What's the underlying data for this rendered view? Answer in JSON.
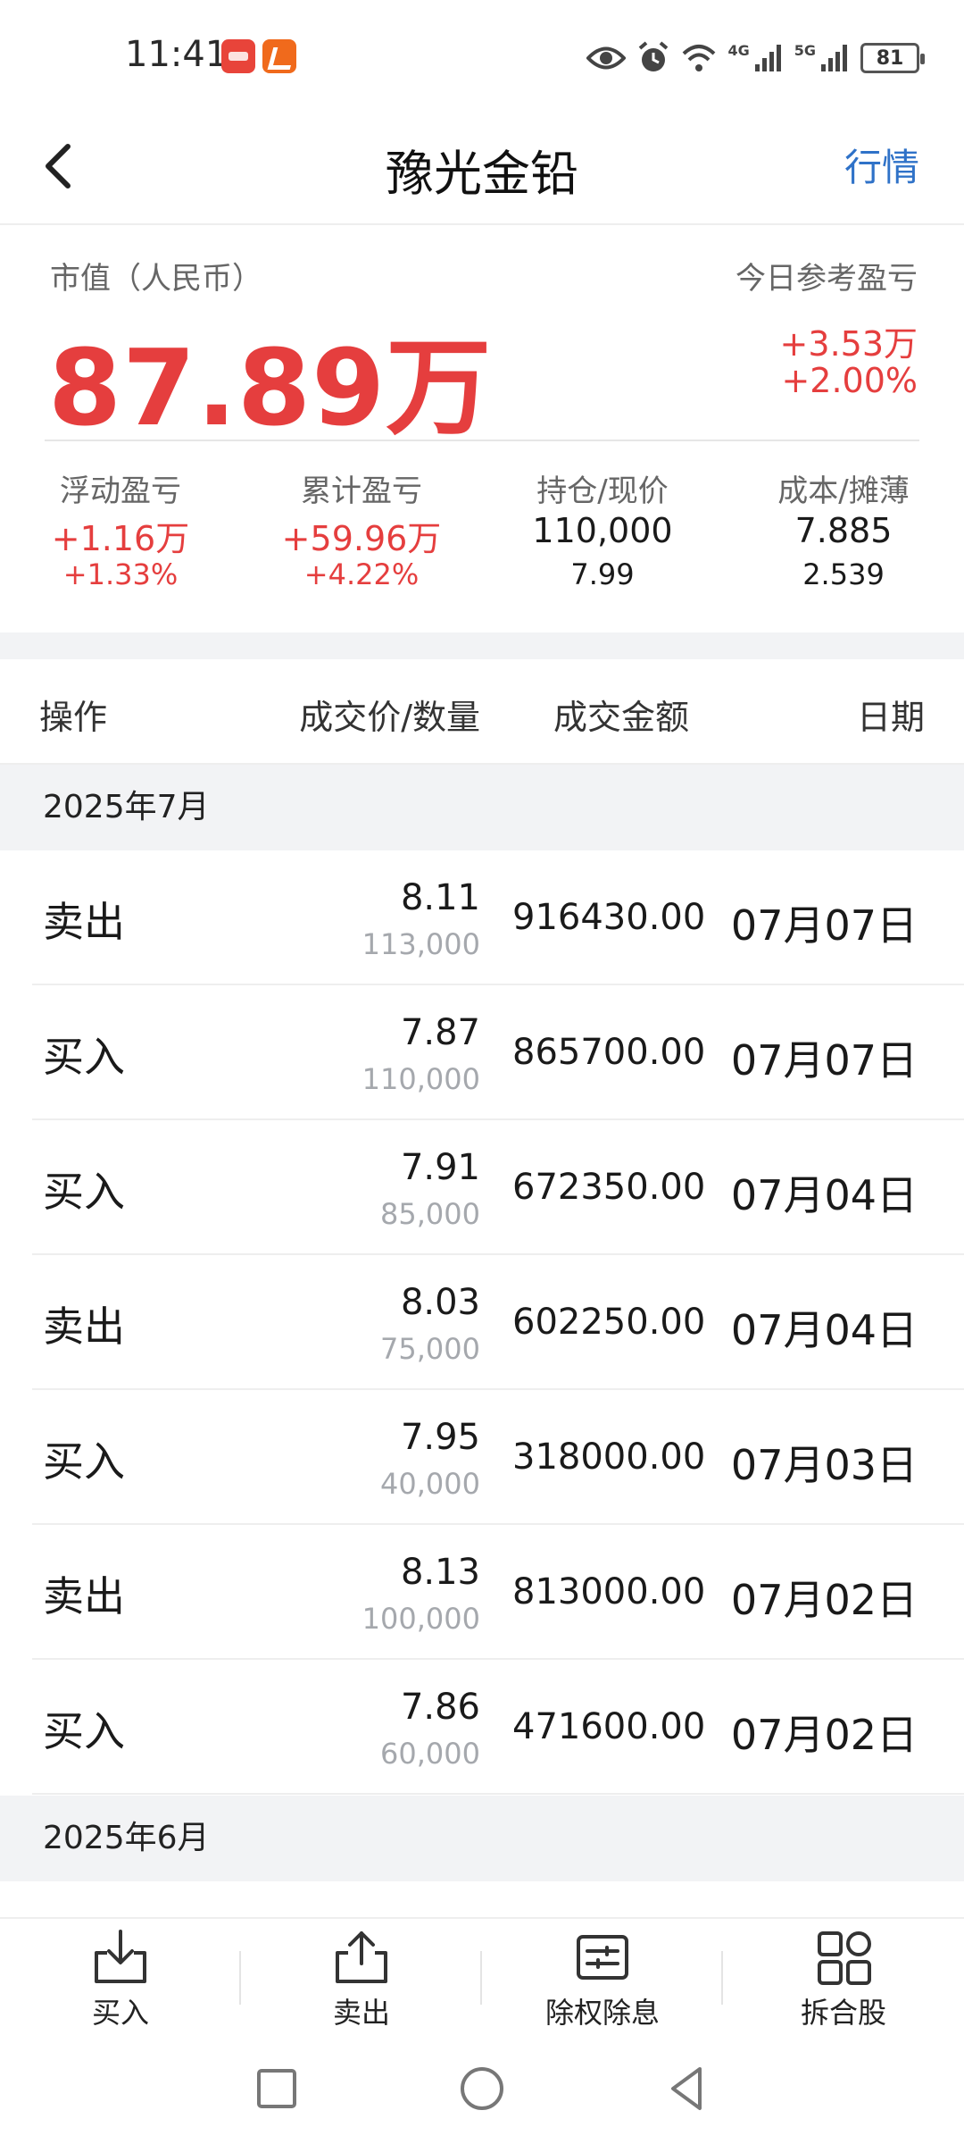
{
  "status_bar": {
    "time": "11:41",
    "network_1": "4G",
    "network_2": "5G",
    "battery": "81"
  },
  "header": {
    "title": "豫光金铅",
    "quote_link": "行情"
  },
  "summary": {
    "market_value_label": "市值（人民币）",
    "market_value": "87.89万",
    "today_label": "今日参考盈亏",
    "today_amount": "+3.53万",
    "today_percent": "+2.00%",
    "stats": [
      {
        "label": "浮动盈亏",
        "v1": "+1.16万",
        "v2": "+1.33%"
      },
      {
        "label": "累计盈亏",
        "v1": "+59.96万",
        "v2": "+4.22%"
      },
      {
        "label": "持仓/现价",
        "v1": "110,000",
        "v2": "7.99"
      },
      {
        "label": "成本/摊薄",
        "v1": "7.885",
        "v2": "2.539"
      }
    ]
  },
  "table": {
    "headers": {
      "operation": "操作",
      "price_qty": "成交价/数量",
      "amount": "成交金额",
      "date": "日期"
    },
    "month_1": "2025年7月",
    "month_2": "2025年6月",
    "rows": [
      {
        "action": "卖出",
        "price": "8.11",
        "qty": "113,000",
        "amount": "916430.00",
        "date": "07月07日"
      },
      {
        "action": "买入",
        "price": "7.87",
        "qty": "110,000",
        "amount": "865700.00",
        "date": "07月07日"
      },
      {
        "action": "买入",
        "price": "7.91",
        "qty": "85,000",
        "amount": "672350.00",
        "date": "07月04日"
      },
      {
        "action": "卖出",
        "price": "8.03",
        "qty": "75,000",
        "amount": "602250.00",
        "date": "07月04日"
      },
      {
        "action": "买入",
        "price": "7.95",
        "qty": "40,000",
        "amount": "318000.00",
        "date": "07月03日"
      },
      {
        "action": "卖出",
        "price": "8.13",
        "qty": "100,000",
        "amount": "813000.00",
        "date": "07月02日"
      },
      {
        "action": "买入",
        "price": "7.86",
        "qty": "60,000",
        "amount": "471600.00",
        "date": "07月02日"
      }
    ]
  },
  "toolbar": {
    "buy": "买入",
    "sell": "卖出",
    "ex_rights": "除权除息",
    "split_merge": "拆合股"
  },
  "colors": {
    "gain_red": "#e53e3e",
    "link_blue": "#2f72c8",
    "band_gray": "#f2f3f5"
  }
}
